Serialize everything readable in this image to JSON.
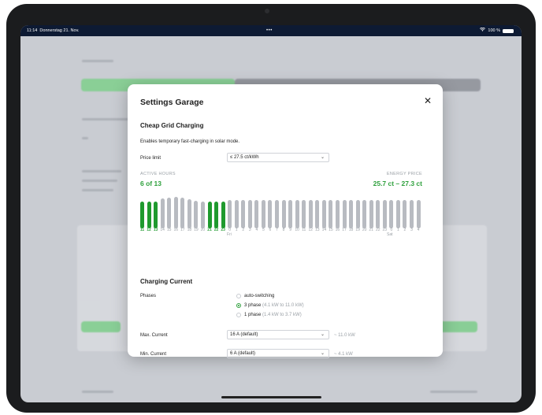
{
  "statusbar": {
    "time": "11:14",
    "date": "Donnerstag 21. Nov.",
    "dots": "•••",
    "battery": "100 %"
  },
  "modal": {
    "title": "Settings Garage",
    "close_icon": "close-icon",
    "cheap_grid": {
      "title": "Cheap Grid Charging",
      "description": "Enables temporary fast-charging in solar mode.",
      "price_limit_label": "Price limit",
      "price_limit_value": "≤ 27.5 ct/kWh",
      "active_hours_label": "ACTIVE HOURS",
      "active_hours_value": "6 of 13",
      "energy_price_label": "ENERGY PRICE",
      "energy_price_value": "25.7 ct – 27.3 ct",
      "hours": [
        "11",
        "12",
        "13",
        "14",
        "15",
        "16",
        "17",
        "18",
        "19",
        "20",
        "21",
        "22",
        "23",
        "0",
        "1",
        "2",
        "3",
        "4",
        "5",
        "6",
        "7",
        "8",
        "9",
        "10",
        "11",
        "12",
        "13",
        "14",
        "15",
        "16",
        "17",
        "18",
        "19",
        "20",
        "21",
        "22",
        "23",
        "0",
        "1",
        "2",
        "3",
        "4"
      ],
      "active": [
        true,
        true,
        true,
        false,
        false,
        false,
        false,
        false,
        false,
        false,
        true,
        true,
        true,
        false,
        false,
        false,
        false,
        false,
        false,
        false,
        false,
        false,
        false,
        false,
        false,
        false,
        false,
        false,
        false,
        false,
        false,
        false,
        false,
        false,
        false,
        false,
        false,
        false,
        false,
        false,
        false,
        false
      ],
      "heights": [
        0.85,
        0.85,
        0.85,
        0.95,
        0.98,
        1.0,
        0.98,
        0.93,
        0.88,
        0.85,
        0.85,
        0.85,
        0.85,
        0.9,
        0.9,
        0.9,
        0.9,
        0.9,
        0.9,
        0.9,
        0.9,
        0.9,
        0.9,
        0.9,
        0.9,
        0.9,
        0.9,
        0.9,
        0.9,
        0.9,
        0.9,
        0.9,
        0.9,
        0.9,
        0.9,
        0.9,
        0.9,
        0.9,
        0.9,
        0.9,
        0.9,
        0.9
      ],
      "day_labels": {
        "fri": "Fri",
        "sat": "Sat"
      },
      "active_color": "#1f9a2e",
      "inactive_color": "#b8bbc1"
    },
    "charging_current": {
      "title": "Charging Current",
      "phases_label": "Phases",
      "options": [
        {
          "label": "auto-switching",
          "detail": "",
          "checked": false
        },
        {
          "label": "3 phase",
          "detail": "(4.1 kW to 11.0 kW)",
          "checked": true
        },
        {
          "label": "1 phase",
          "detail": "(1.4 kW to 3.7 kW)",
          "checked": false
        }
      ],
      "max_label": "Max. Current",
      "max_value": "16 A (default)",
      "max_hint": "~ 11.0 kW",
      "min_label": "Min. Current",
      "min_value": "6 A (default)",
      "min_hint": "~ 4.1 kW"
    }
  }
}
